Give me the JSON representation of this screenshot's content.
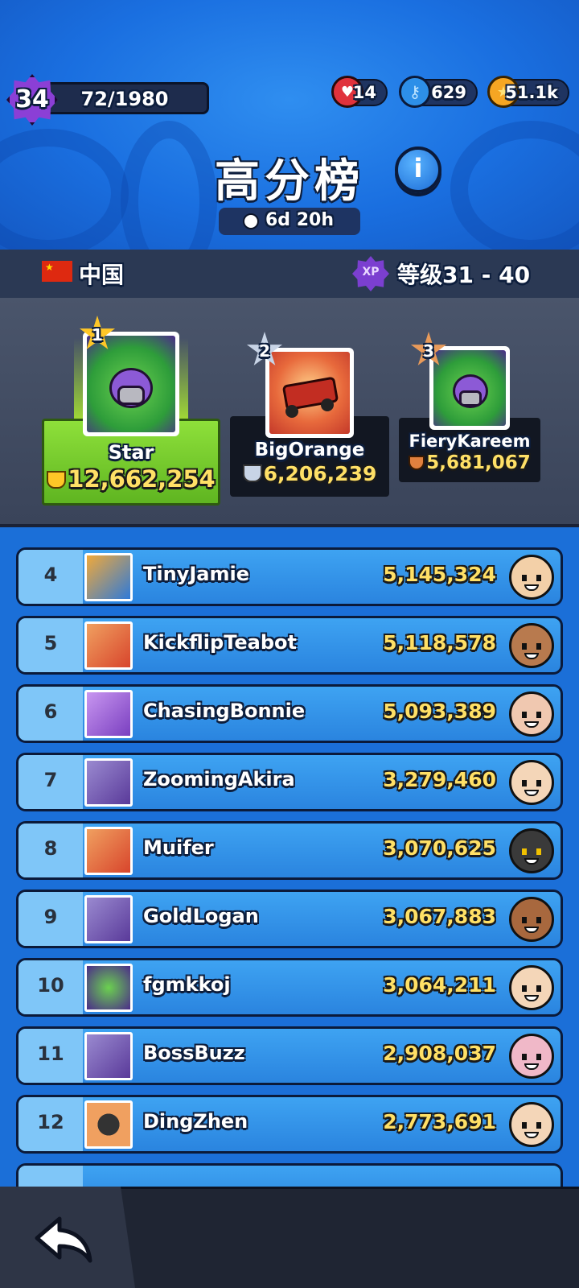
{
  "header": {
    "level": "34",
    "xp_progress": "72/1980",
    "currencies": [
      {
        "icon": "energy-can-icon",
        "value": "14"
      },
      {
        "icon": "key-icon",
        "value": "629"
      },
      {
        "icon": "coin-icon",
        "value": "51.1k"
      }
    ],
    "title": "高分榜",
    "info_glyph": "i",
    "timer": "6d 20h"
  },
  "filters": {
    "country": "中国",
    "xp_label": "XP",
    "level_range": "等级31 - 40"
  },
  "podium": [
    {
      "rank": "1",
      "name": "Star",
      "score": "12,662,254"
    },
    {
      "rank": "2",
      "name": "BigOrange",
      "score": "6,206,239"
    },
    {
      "rank": "3",
      "name": "FieryKareem",
      "score": "5,681,067"
    }
  ],
  "leaderboard": [
    {
      "rank": "4",
      "name": "TinyJamie",
      "score": "5,145,324"
    },
    {
      "rank": "5",
      "name": "KickflipTeabot",
      "score": "5,118,578"
    },
    {
      "rank": "6",
      "name": "ChasingBonnie",
      "score": "5,093,389"
    },
    {
      "rank": "7",
      "name": "ZoomingAkira",
      "score": "3,279,460"
    },
    {
      "rank": "8",
      "name": "Muifer",
      "score": "3,070,625"
    },
    {
      "rank": "9",
      "name": "GoldLogan",
      "score": "3,067,883"
    },
    {
      "rank": "10",
      "name": "fgmkkoj",
      "score": "3,064,211"
    },
    {
      "rank": "11",
      "name": "BossBuzz",
      "score": "2,908,037"
    },
    {
      "rank": "12",
      "name": "DingZhen",
      "score": "2,773,691"
    }
  ],
  "colors": {
    "background": "#1b6fd8",
    "row": "#3ea3f2",
    "gold_text": "#ffe066",
    "first_place": "#7ed321",
    "xp_purple": "#8b3fd6"
  }
}
